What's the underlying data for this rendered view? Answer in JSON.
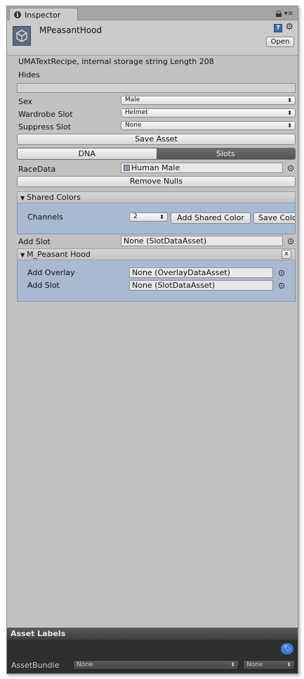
{
  "tab": {
    "title": "Inspector"
  },
  "header": {
    "title": "MPeasantHood",
    "open_label": "Open"
  },
  "info_text": "UMATextRecipe, internal storage string Length 208",
  "hides_label": "Hides",
  "sex": {
    "label": "Sex",
    "value": "Male"
  },
  "wardrobe_slot": {
    "label": "Wardrobe Slot",
    "value": "Helmet"
  },
  "suppress_slot": {
    "label": "Suppress Slot",
    "value": "None"
  },
  "save_asset_label": "Save Asset",
  "tabs": {
    "dna": "DNA",
    "slots": "Slots"
  },
  "race_data": {
    "label": "RaceData",
    "value": "Human Male"
  },
  "remove_nulls_label": "Remove Nulls",
  "shared_colors": {
    "title": "Shared Colors",
    "channels_label": "Channels",
    "channels_value": "2",
    "add_shared_color_label": "Add Shared Color",
    "save_colors_label": "Save Colo"
  },
  "add_slot": {
    "label": "Add Slot",
    "value": "None (SlotDataAsset)"
  },
  "slot_section": {
    "title": "M_Peasant Hood",
    "close_label": "x",
    "add_overlay_label": "Add Overlay",
    "add_overlay_value": "None (OverlayDataAsset)",
    "add_slot_label": "Add Slot",
    "add_slot_value": "None (SlotDataAsset)"
  },
  "asset_labels": {
    "title": "Asset Labels",
    "asset_bundle_label": "AssetBundle",
    "bundle_value": "None",
    "variant_value": "None"
  }
}
